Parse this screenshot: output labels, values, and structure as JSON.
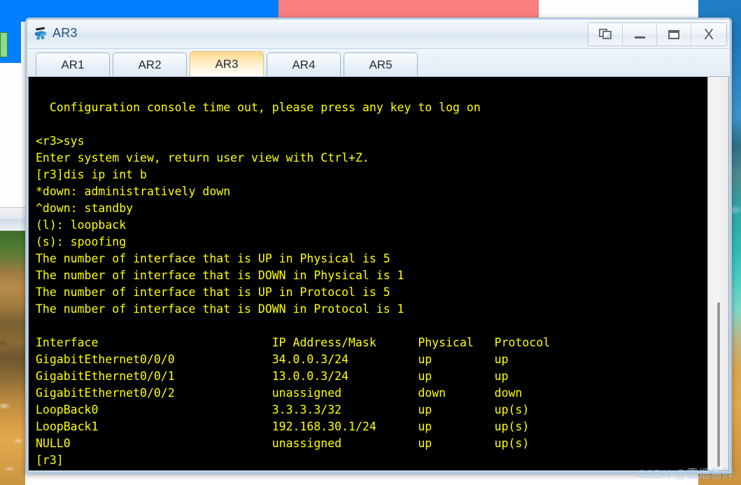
{
  "desktop": {
    "colors": {
      "blue_panel": "#0080ff",
      "salmon_panel": "#f97e7e",
      "white_panel": "#fdfdfd"
    }
  },
  "window": {
    "title": "AR3",
    "icon": "router-icon",
    "controls": {
      "restore_label": "",
      "minimize_label": "",
      "maximize_label": "",
      "close_label": "X"
    }
  },
  "tabs": {
    "active_index": 2,
    "items": [
      {
        "label": "AR1"
      },
      {
        "label": "AR2"
      },
      {
        "label": "AR3"
      },
      {
        "label": "AR4"
      },
      {
        "label": "AR5"
      }
    ]
  },
  "console": {
    "text_color": "#ffff00",
    "background_color": "#000000",
    "lines": [
      "",
      "  Configuration console time out, please press any key to log on",
      "",
      "<r3>sys",
      "Enter system view, return user view with Ctrl+Z.",
      "[r3]dis ip int b",
      "*down: administratively down",
      "^down: standby",
      "(l): loopback",
      "(s): spoofing",
      "The number of interface that is UP in Physical is 5",
      "The number of interface that is DOWN in Physical is 1",
      "The number of interface that is UP in Protocol is 5",
      "The number of interface that is DOWN in Protocol is 1",
      "",
      "Interface                         IP Address/Mask      Physical   Protocol",
      "GigabitEthernet0/0/0              34.0.0.3/24          up         up",
      "GigabitEthernet0/0/1              13.0.0.3/24          up         up",
      "GigabitEthernet0/0/2              unassigned           down       down",
      "LoopBack0                         3.3.3.3/32           up         up(s)",
      "LoopBack1                         192.168.30.1/24      up         up(s)",
      "NULL0                             unassigned           up         up(s)",
      "[r3]"
    ],
    "counters": {
      "up_physical": 5,
      "down_physical": 1,
      "up_protocol": 5,
      "down_protocol": 1
    },
    "legend": [
      "*down: administratively down",
      "^down: standby",
      "(l): loopback",
      "(s): spoofing"
    ],
    "prompt_user_view": "<r3>",
    "prompt_system_view": "[r3]",
    "commands": [
      "sys",
      "dis ip int b"
    ],
    "table": {
      "headers": [
        "Interface",
        "IP Address/Mask",
        "Physical",
        "Protocol"
      ],
      "rows": [
        [
          "GigabitEthernet0/0/0",
          "34.0.0.3/24",
          "up",
          "up"
        ],
        [
          "GigabitEthernet0/0/1",
          "13.0.0.3/24",
          "up",
          "up"
        ],
        [
          "GigabitEthernet0/0/2",
          "unassigned",
          "down",
          "down"
        ],
        [
          "LoopBack0",
          "3.3.3.3/32",
          "up",
          "up(s)"
        ],
        [
          "LoopBack1",
          "192.168.30.1/24",
          "up",
          "up(s)"
        ],
        [
          "NULL0",
          "unassigned",
          "up",
          "up(s)"
        ]
      ]
    }
  },
  "scrollbar": {
    "orientation": "vertical"
  },
  "watermark": {
    "text": "CSDN @霜烟易碎"
  }
}
